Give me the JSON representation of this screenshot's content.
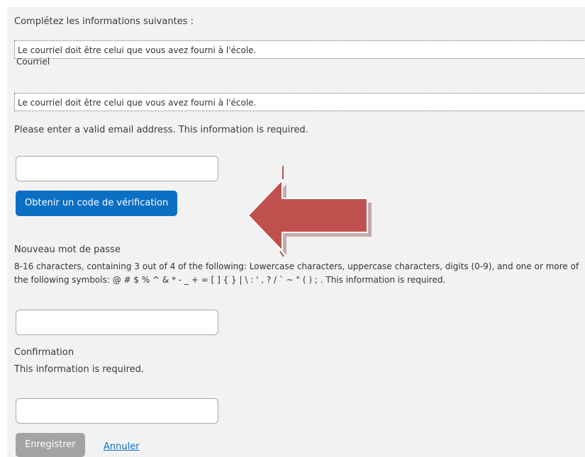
{
  "form": {
    "intro": "Complétez les informations suivantes :",
    "email_hint_1": "Le courriel doit être celui que vous avez fourni à l'école.",
    "email_label": "Courriel",
    "email_hint_2": "Le courriel doit être celui que vous avez fourni à l'école.",
    "email_error": "Please enter a valid email address. This information is required.",
    "email_value": "",
    "verify_button": "Obtenir un code de vérification",
    "password_label": "Nouveau mot de passe",
    "password_description": "8-16 characters, containing 3 out of 4 of the following: Lowercase characters, uppercase characters, digits (0-9), and one or more of the following symbols: @ # $ % ^ & * - _ + = [ ] { } | \\ : ' , ? / ` ~ \" ( ) ; . This information is required.",
    "password_value": "",
    "confirm_label": "Confirmation",
    "confirm_required": "This information is required.",
    "confirm_value": "",
    "save_button": "Enregistrer",
    "cancel_link": "Annuler"
  },
  "annotation": {
    "icon": "left-arrow-icon",
    "color": "#c0504d"
  },
  "colors": {
    "primary_button": "#0b6fc4",
    "disabled_button": "#a3a3a3",
    "panel_background": "#f2f2f2",
    "link": "#0b6fc4"
  }
}
